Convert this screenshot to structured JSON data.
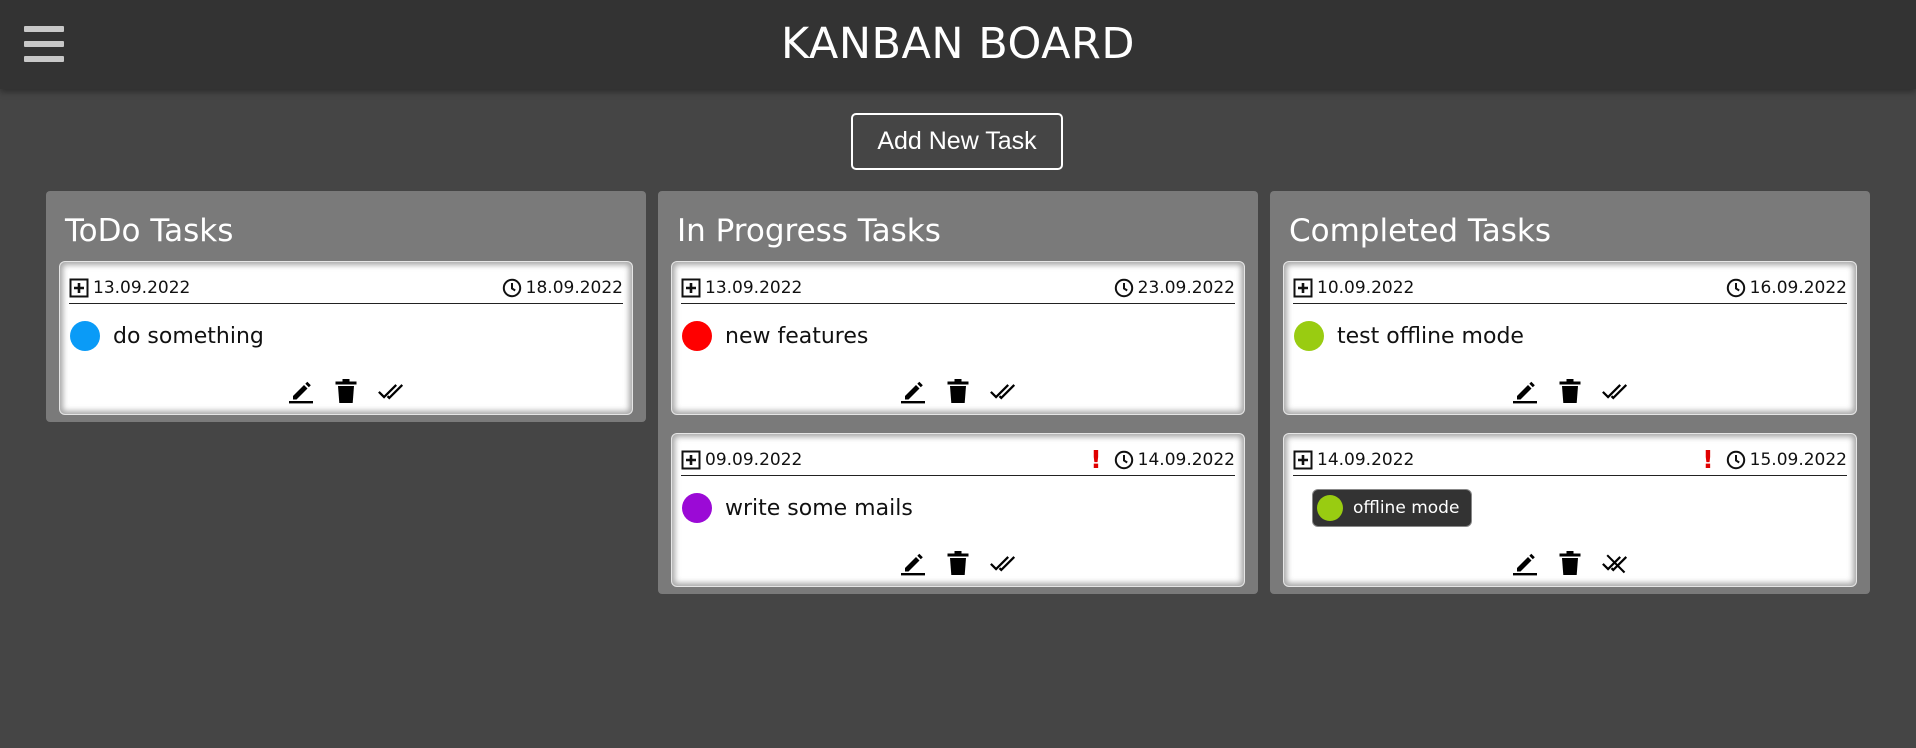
{
  "header": {
    "title": "KANBAN BOARD",
    "menu_icon": "hamburger-menu-icon"
  },
  "toolbar": {
    "add_label": "Add New Task"
  },
  "colors": {
    "blue": "#0a9bf7",
    "red": "#ff0000",
    "purple": "#9b0ad6",
    "green": "#99cc11",
    "alert": "#e00000"
  },
  "columns": [
    {
      "title": "ToDo Tasks",
      "cards": [
        {
          "created": "13.09.2022",
          "due": "18.09.2022",
          "overdue": false,
          "text": "do something",
          "color": "#0a9bf7",
          "status_icon": "double-check-icon"
        }
      ]
    },
    {
      "title": "In Progress Tasks",
      "cards": [
        {
          "created": "13.09.2022",
          "due": "23.09.2022",
          "overdue": false,
          "text": "new features",
          "color": "#ff0000",
          "status_icon": "double-check-icon"
        },
        {
          "created": "09.09.2022",
          "due": "14.09.2022",
          "overdue": true,
          "alert": "!",
          "text": "write some mails",
          "color": "#9b0ad6",
          "status_icon": "double-check-icon"
        }
      ]
    },
    {
      "title": "Completed Tasks",
      "cards": [
        {
          "created": "10.09.2022",
          "due": "16.09.2022",
          "overdue": false,
          "text": "test offline mode",
          "color": "#99cc11",
          "status_icon": "double-check-icon"
        },
        {
          "created": "14.09.2022",
          "due": "15.09.2022",
          "overdue": true,
          "alert": "!",
          "tag": "offline mode",
          "color": "#99cc11",
          "status_icon": "uncheck-icon"
        }
      ]
    }
  ]
}
